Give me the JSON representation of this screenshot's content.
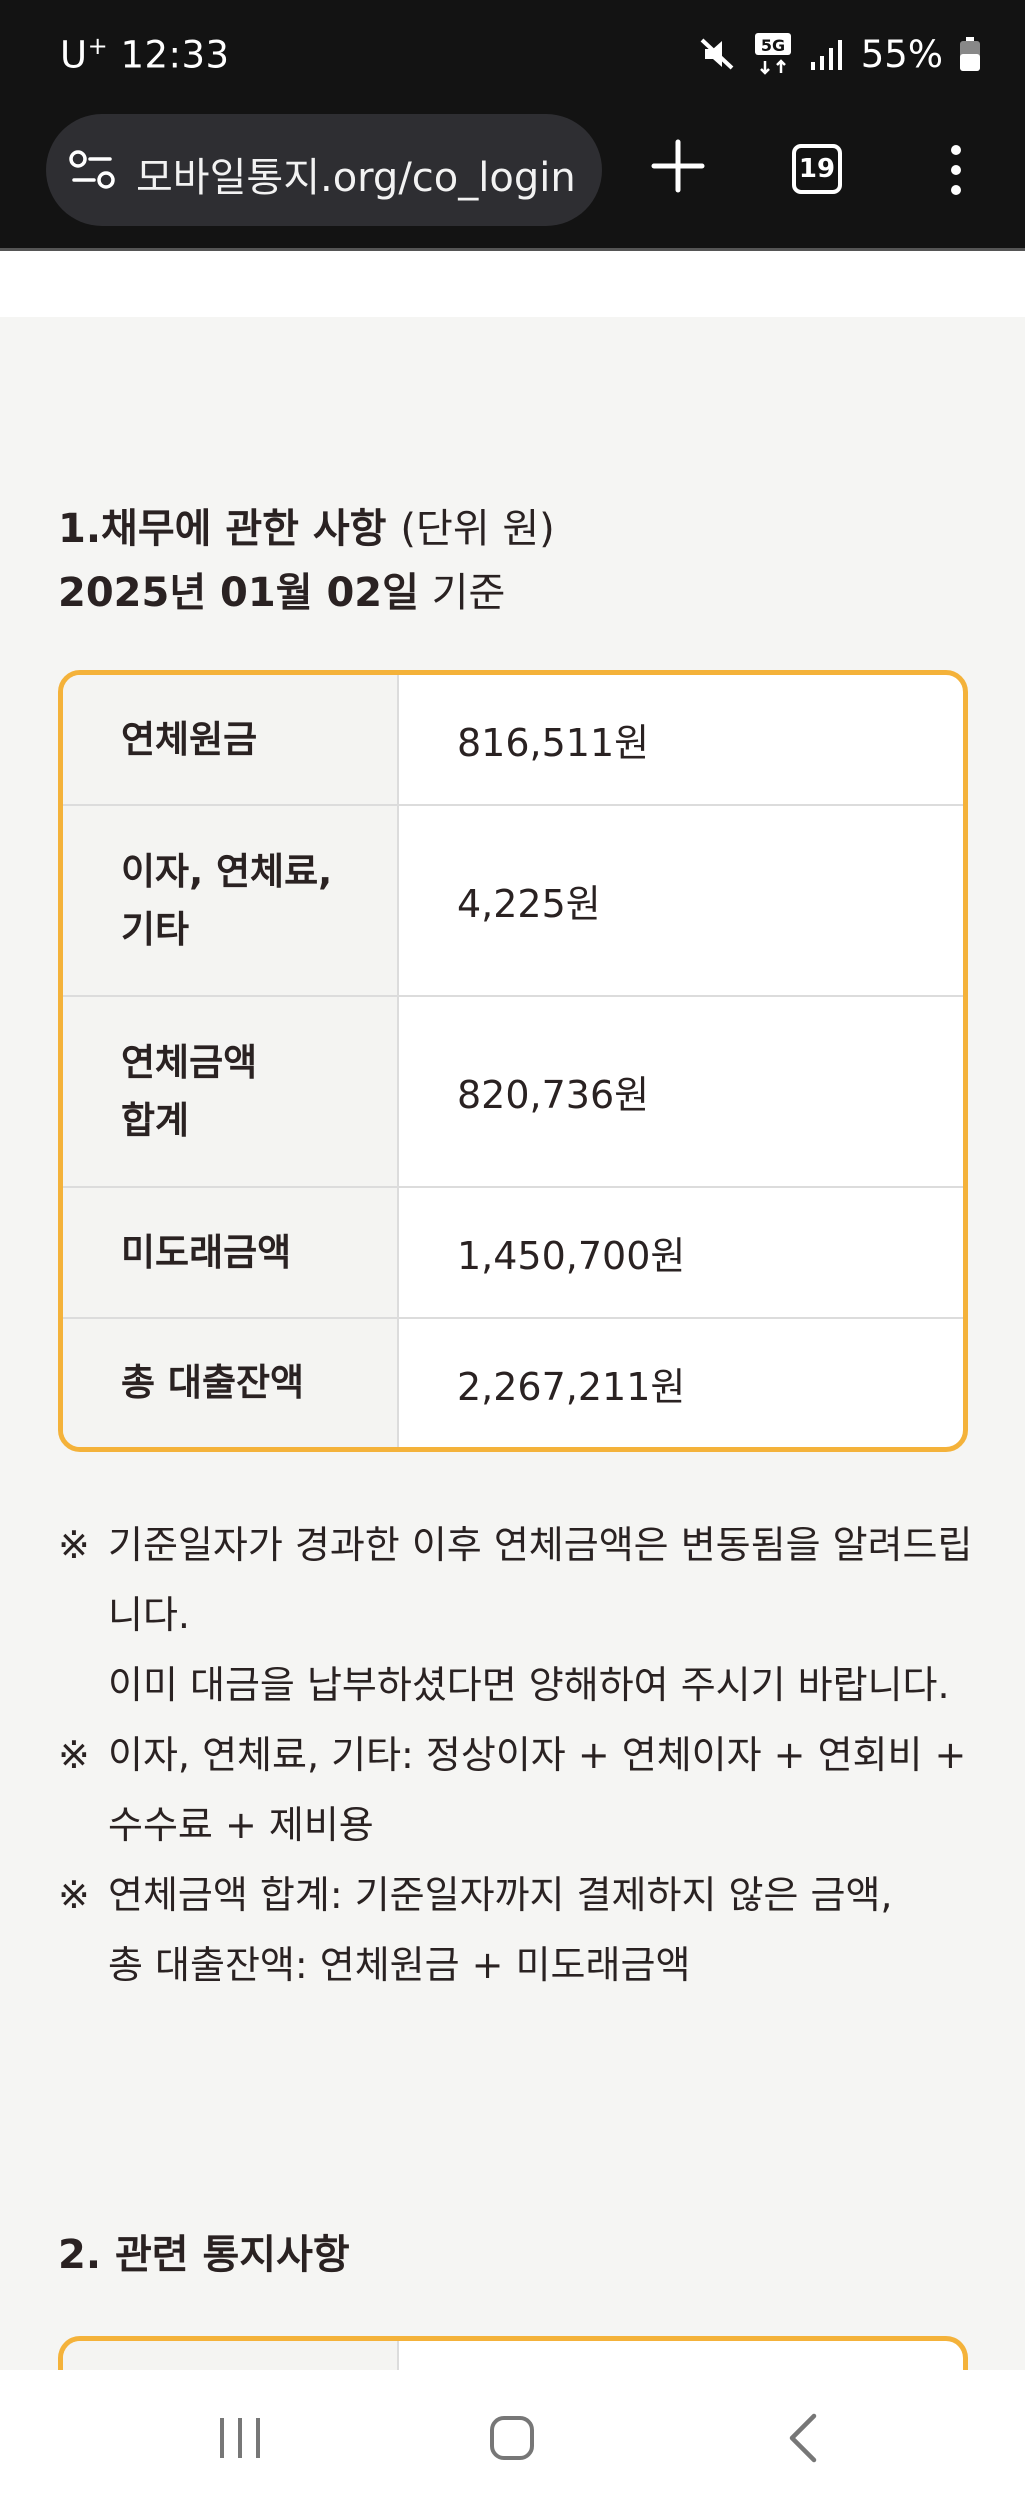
{
  "status_bar": {
    "carrier": "U",
    "carrier_sup": "+",
    "time": "12:33",
    "battery": "55%",
    "icons": [
      "mute-icon",
      "5g-icon",
      "signal-icon",
      "battery-icon"
    ]
  },
  "browser": {
    "url": "모바일통지.org/co_login",
    "tab_count": "19",
    "icons": [
      "site-settings-icon",
      "new-tab-plus-icon",
      "tab-switcher-icon",
      "more-menu-icon"
    ]
  },
  "section1": {
    "title": "1.채무에 관한 사항",
    "unit": "(단위 원)",
    "date_bold": "2025년 01월 02일",
    "date_suffix": "기준",
    "rows": [
      {
        "label": "연체원금",
        "value": "816,511원"
      },
      {
        "label": "이자, 연체료,\n기타",
        "value": "4,225원"
      },
      {
        "label": "연체금액\n합계",
        "value": "820,736원"
      },
      {
        "label": "미도래금액",
        "value": "1,450,700원"
      },
      {
        "label": "총 대출잔액",
        "value": "2,267,211원"
      }
    ]
  },
  "notes": [
    {
      "mark": "※",
      "text": "기준일자가 경과한 이후 연체금액은 변동됨을 알려드립니다.",
      "text2": "이미 대금을 납부하셨다면 양해하여 주시기 바랍니다."
    },
    {
      "mark": "※",
      "text": "이자, 연체료, 기타: 정상이자 + 연체이자 + 연회비 + 수수료 + 제비용",
      "text2": ""
    },
    {
      "mark": "※",
      "text": "연체금액 합계: 기준일자까지 결제하지 않은 금액,",
      "text2": "총 대출잔액: 연체원금 + 미도래금액"
    }
  ],
  "section2": {
    "title": "2. 관련 통지사항"
  },
  "nav": {
    "icons": [
      "recent-apps-icon",
      "home-icon",
      "back-icon"
    ]
  },
  "colors": {
    "accent_border": "#f4b23a",
    "chrome_bg": "#131313",
    "page_bg": "#f5f5f3"
  }
}
